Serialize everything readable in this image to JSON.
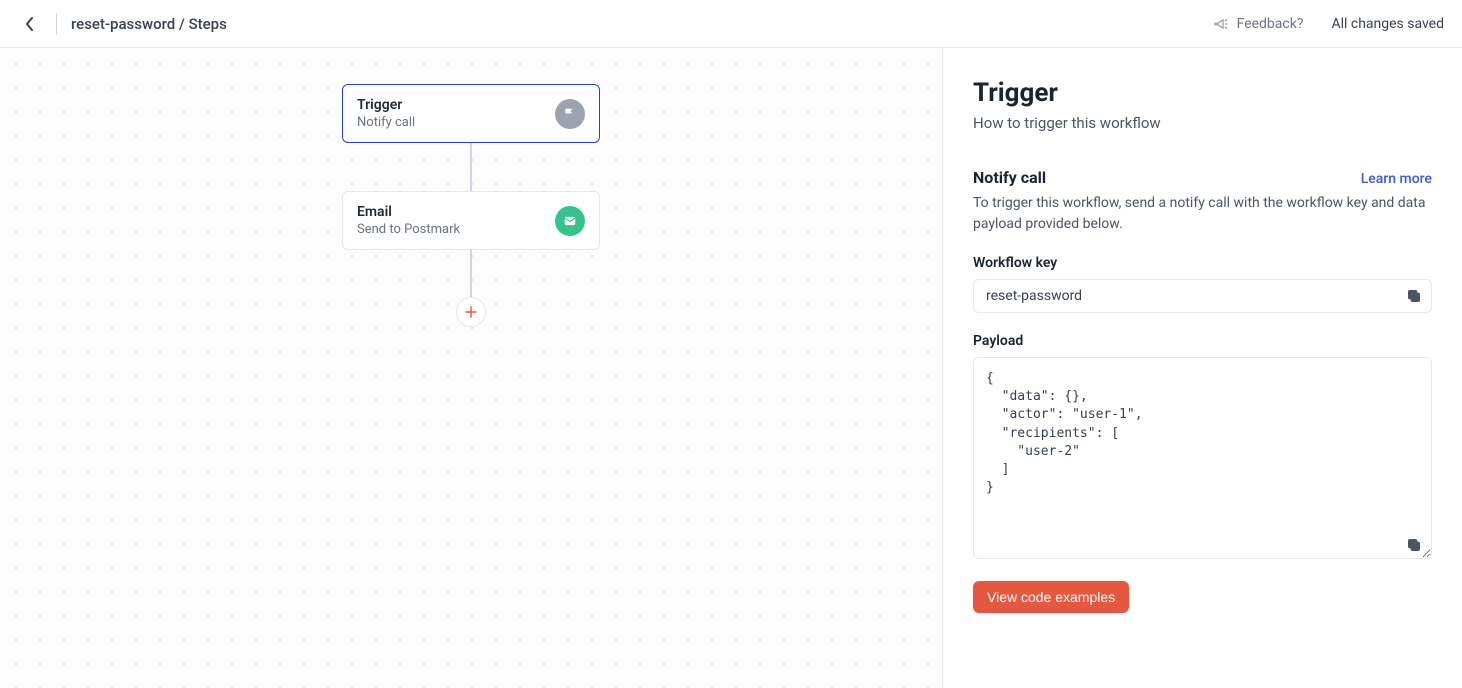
{
  "header": {
    "breadcrumb": "reset-password / Steps",
    "feedback_label": "Feedback?",
    "saved_status": "All changes saved"
  },
  "canvas": {
    "nodes": [
      {
        "title": "Trigger",
        "subtitle": "Notify call",
        "icon": "flag",
        "selected": true
      },
      {
        "title": "Email",
        "subtitle": "Send to Postmark",
        "icon": "mail",
        "selected": false
      }
    ]
  },
  "panel": {
    "title": "Trigger",
    "subtitle": "How to trigger this workflow",
    "section_title": "Notify call",
    "learn_more": "Learn more",
    "section_desc": "To trigger this workflow, send a notify call with the workflow key and data payload provided below.",
    "workflow_key_label": "Workflow key",
    "workflow_key_value": "reset-password",
    "payload_label": "Payload",
    "payload_value": "{\n  \"data\": {},\n  \"actor\": \"user-1\",\n  \"recipients\": [\n    \"user-2\"\n  ]\n}",
    "view_code_label": "View code examples"
  }
}
